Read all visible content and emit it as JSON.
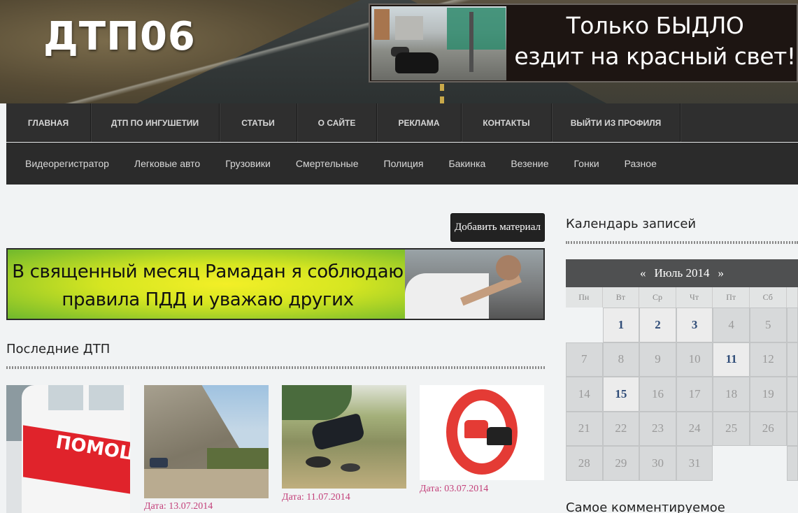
{
  "site": {
    "logo": "ДТП06",
    "banner_text_line1": "Только БЫДЛО",
    "banner_text_line2": "ездит на красный свет!"
  },
  "nav_main": [
    "ГЛАВНАЯ",
    "ДТП ПО ИНГУШЕТИИ",
    "СТАТЬИ",
    "О САЙТЕ",
    "РЕКЛАМА",
    "КОНТАКТЫ",
    "ВЫЙТИ ИЗ ПРОФИЛЯ"
  ],
  "nav_categories": [
    "Видеорегистратор",
    "Легковые авто",
    "Грузовики",
    "Смертельные",
    "Полиция",
    "Бакинка",
    "Везение",
    "Гонки",
    "Разное"
  ],
  "add_material_label": "Добавить материал",
  "ramadan_banner": {
    "line1": "В священный месяц Рамадан я соблюдаю",
    "line2": "правила ПДД и уважаю других участников!"
  },
  "latest": {
    "title": "Последние ДТП",
    "cards": [
      {
        "date": ""
      },
      {
        "date": "Дата: 13.07.2014"
      },
      {
        "date": "Дата: 11.07.2014"
      },
      {
        "date": "Дата: 03.07.2014"
      }
    ]
  },
  "ambulance_text": "ПОМОЩЬ",
  "calendar": {
    "title": "Календарь записей",
    "prev": "«",
    "next": "»",
    "month_label": "Июль 2014",
    "weekdays": [
      "Пн",
      "Вт",
      "Ср",
      "Чт",
      "Пт",
      "Сб"
    ],
    "weeks": [
      [
        "",
        "1",
        "2",
        "3",
        "4",
        "5"
      ],
      [
        "7",
        "8",
        "9",
        "10",
        "11",
        "12"
      ],
      [
        "14",
        "15",
        "16",
        "17",
        "18",
        "19"
      ],
      [
        "21",
        "22",
        "23",
        "24",
        "25",
        "26"
      ],
      [
        "28",
        "29",
        "30",
        "31",
        "",
        ""
      ]
    ],
    "linked_days": [
      "1",
      "2",
      "3",
      "11",
      "15"
    ]
  },
  "most_commented_title": "Самое комментируемое"
}
